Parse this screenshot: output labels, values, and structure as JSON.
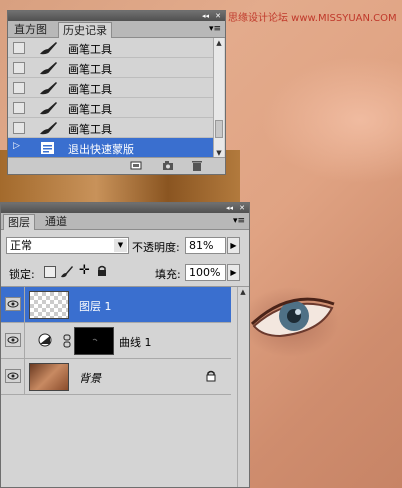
{
  "watermark": "思缘设计论坛 www.MISSYUAN.COM",
  "history": {
    "tabs": [
      "直方图",
      "历史记录"
    ],
    "items": [
      {
        "label": "画笔工具",
        "icon": "brush-icon"
      },
      {
        "label": "画笔工具",
        "icon": "brush-icon"
      },
      {
        "label": "画笔工具",
        "icon": "brush-icon"
      },
      {
        "label": "画笔工具",
        "icon": "brush-icon"
      },
      {
        "label": "画笔工具",
        "icon": "brush-icon"
      },
      {
        "label": "退出快速蒙版",
        "icon": "quick-mask-icon",
        "selected": true
      }
    ]
  },
  "layers": {
    "tabs": [
      "图层",
      "通道"
    ],
    "blend_mode": "正常",
    "opacity_label": "不透明度:",
    "opacity_value": "81%",
    "lock_label": "锁定:",
    "fill_label": "填充:",
    "fill_value": "100%",
    "items": [
      {
        "name": "图层 1",
        "selected": true,
        "thumbnail": "transparent"
      },
      {
        "name": "曲线 1",
        "selected": false,
        "thumbnail": "adjustment-mask"
      },
      {
        "name": "背景",
        "selected": false,
        "thumbnail": "photo",
        "locked": true
      }
    ]
  },
  "colors": {
    "selection": "#3a6fcf",
    "panel": "#d4d4d4",
    "titlebar": "#5a5a5a"
  }
}
